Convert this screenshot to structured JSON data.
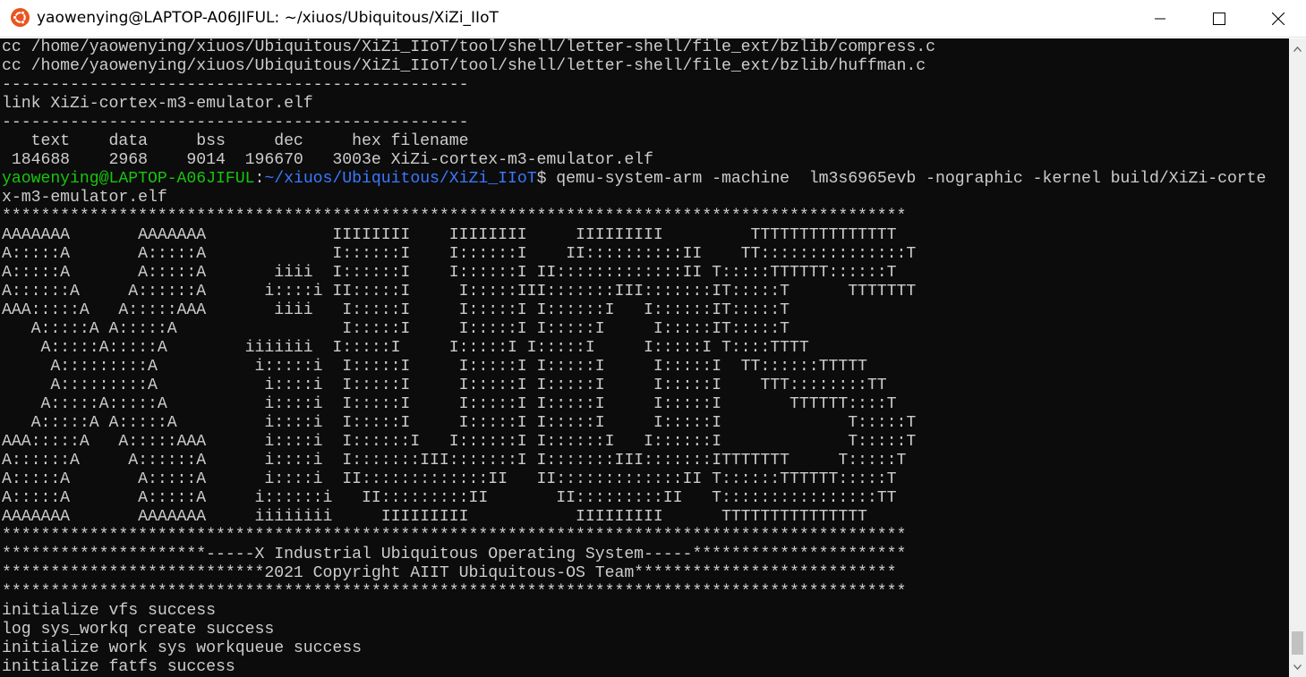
{
  "window": {
    "title": "yaowenying@LAPTOP-A06JIFUL: ~/xiuos/Ubiquitous/XiZi_IIoT",
    "icon": "ubuntu-icon",
    "accent": "#e95420",
    "controls": [
      "minimize-icon",
      "maximize-icon",
      "close-icon"
    ]
  },
  "terminal": {
    "background": "#0c0c0c",
    "foreground": "#cccccc",
    "prompt_user_color": "#16c60c",
    "prompt_path_color": "#3b78ff",
    "lines": [
      "cc /home/yaowenying/xiuos/Ubiquitous/XiZi_IIoT/tool/shell/letter-shell/file_ext/bzlib/compress.c",
      "cc /home/yaowenying/xiuos/Ubiquitous/XiZi_IIoT/tool/shell/letter-shell/file_ext/bzlib/huffman.c",
      "------------------------------------------------",
      "link XiZi-cortex-m3-emulator.elf",
      "------------------------------------------------",
      "   text    data     bss     dec     hex filename",
      " 184688    2968    9014  196670   3003e XiZi-cortex-m3-emulator.elf",
      "",
      "x-m3-emulator.elf",
      "*********************************************************************************************",
      "AAAAAAA       AAAAAAA             IIIIIIII    IIIIIIII     IIIIIIIII         TTTTTTTTTTTTTTT",
      "A:::::A       A:::::A             I::::::I    I::::::I    II::::::::::II    TT:::::::::::::::T",
      "A:::::A       A:::::A       iiii  I::::::I    I::::::I II:::::::::::::II T:::::TTTTTT::::::T",
      "A::::::A     A::::::A      i::::i II:::::I     I:::::III:::::::III:::::::IT:::::T      TTTTTTT",
      "AAA:::::A   A:::::AAA       iiii   I:::::I     I:::::I I::::::I   I::::::IT:::::T",
      "   A:::::A A:::::A                 I:::::I     I:::::I I:::::I     I:::::IT:::::T",
      "    A:::::A:::::A        iiiiiii  I:::::I     I:::::I I:::::I     I:::::I T::::TTTT",
      "     A:::::::::A          i:::::i  I:::::I     I:::::I I:::::I     I:::::I  TT::::::TTTTT",
      "     A:::::::::A           i::::i  I:::::I     I:::::I I:::::I     I:::::I    TTT::::::::TT",
      "    A:::::A:::::A          i::::i  I:::::I     I:::::I I:::::I     I:::::I       TTTTTT::::T",
      "   A:::::A A:::::A         i::::i  I:::::I     I:::::I I:::::I     I:::::I             T:::::T",
      "AAA:::::A   A:::::AAA      i::::i  I::::::I   I::::::I I::::::I   I::::::I             T:::::T",
      "A::::::A     A::::::A      i::::i  I:::::::III:::::::I I:::::::III:::::::ITTTTTTT     T:::::T",
      "A:::::A       A:::::A      i::::i  II:::::::::::::II   II:::::::::::::II T::::::TTTTTT:::::T",
      "A:::::A       A:::::A     i::::::i   II:::::::::II       II:::::::::II   T::::::::::::::::TT",
      "AAAAAAA       AAAAAAA     iiiiiiii     IIIIIIIII           IIIIIIIII      TTTTTTTTTTTTTTT",
      "*********************************************************************************************",
      "*********************-----X Industrial Ubiquitous Operating System-----**********************",
      "***************************2021 Copyright AIIT Ubiquitous-OS Team***************************",
      "*********************************************************************************************",
      "initialize vfs success",
      "log sys_workq create success",
      "initialize work sys workqueue success",
      "initialize fatfs success"
    ],
    "prompt": {
      "user_host": "yaowenying@LAPTOP-A06JIFUL",
      "sep": ":",
      "path": "~/xiuos/Ubiquitous/XiZi_IIoT",
      "symbol": "$",
      "command": " qemu-system-arm -machine  lm3s6965evb -nographic -kernel build/XiZi-corte"
    }
  },
  "scrollbar": {
    "up_icon": "scroll-up-arrow-icon",
    "down_icon": "scroll-down-arrow-icon"
  }
}
